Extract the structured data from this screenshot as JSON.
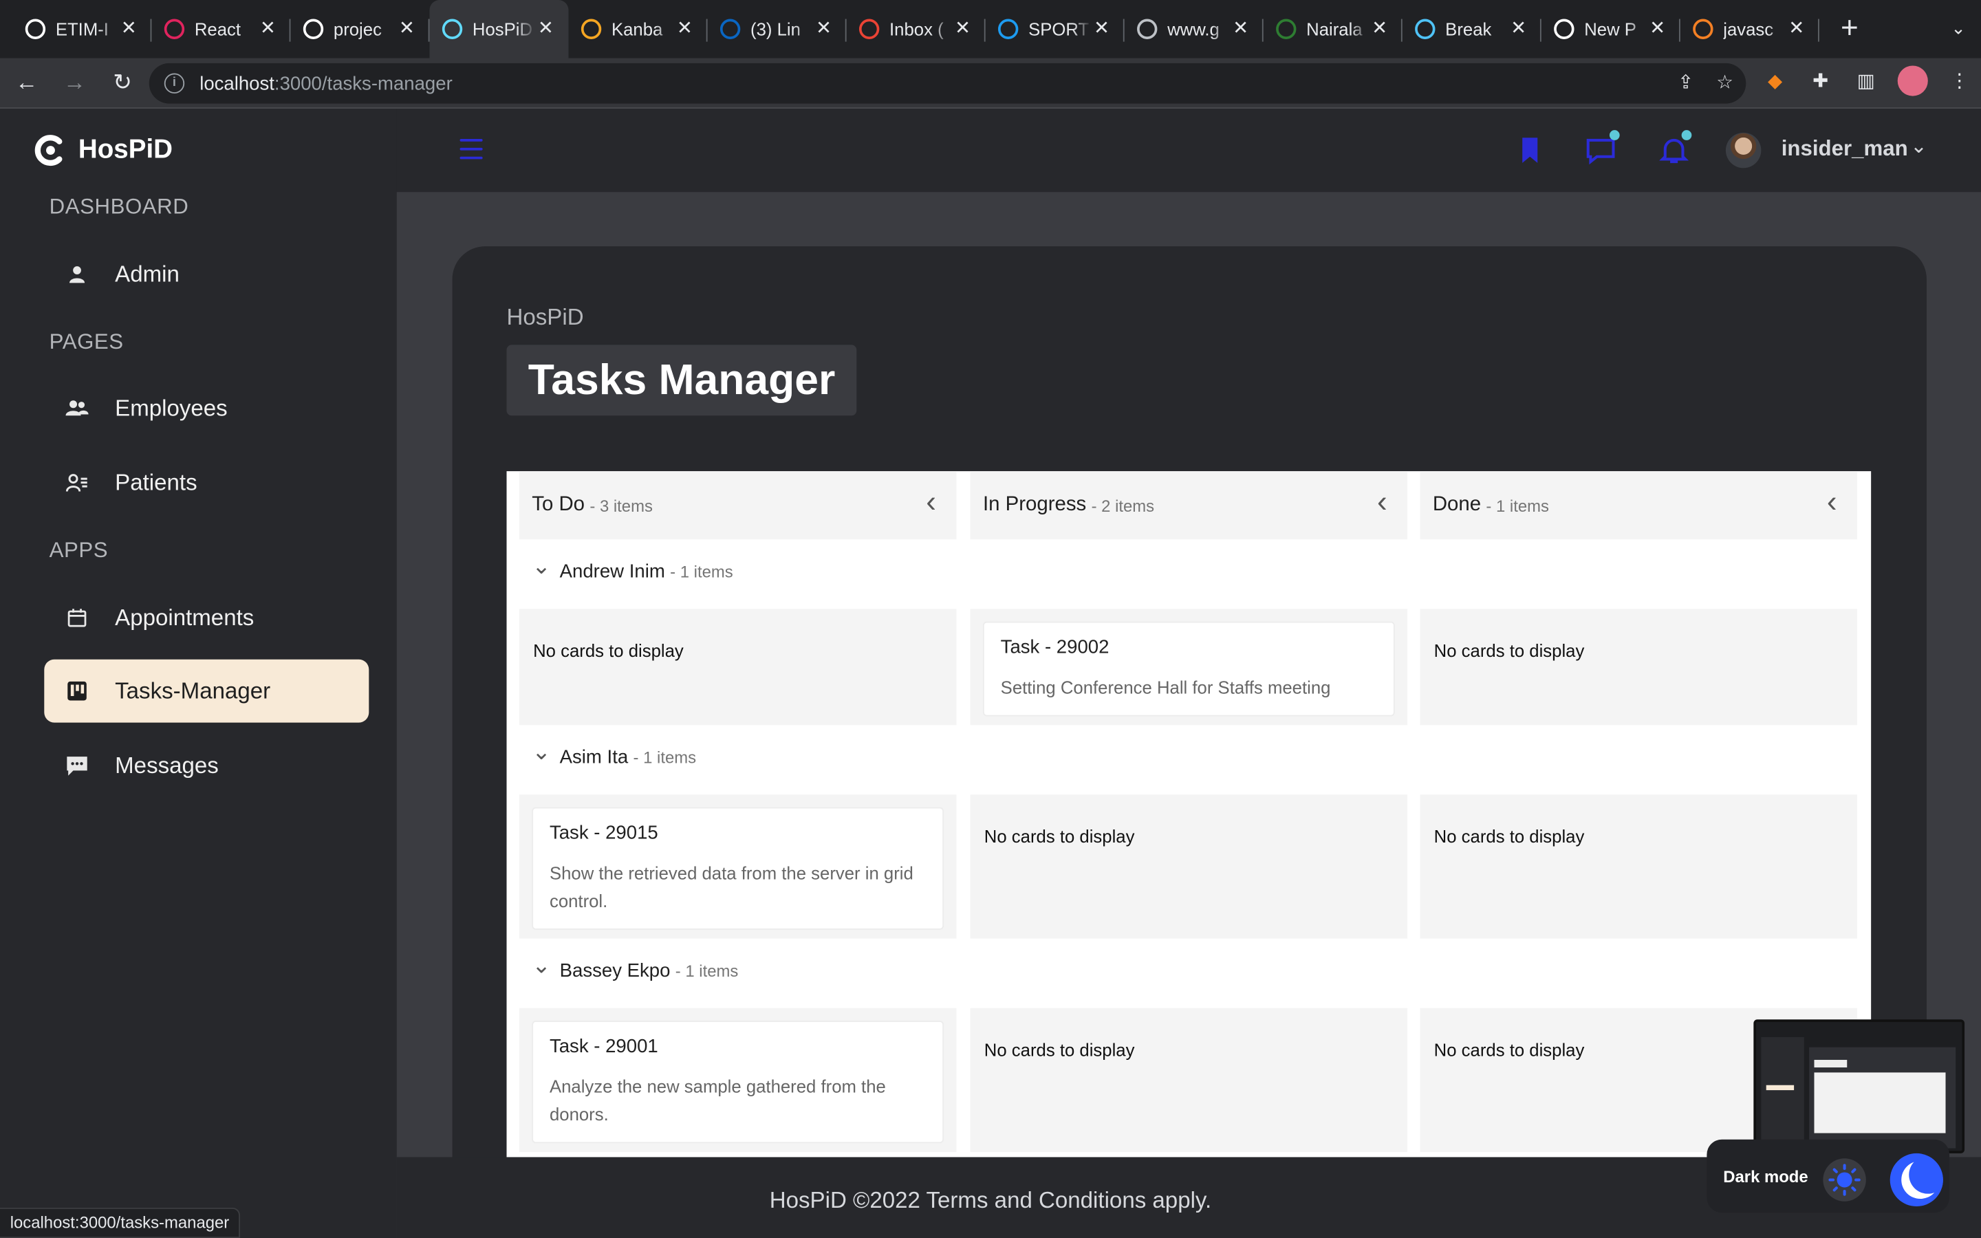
{
  "browser": {
    "tabs": [
      {
        "title": "ETIM-I",
        "favicon": "github-icon",
        "color": "#ffffff"
      },
      {
        "title": "React",
        "favicon": "react-icon",
        "color": "#e0245e"
      },
      {
        "title": "projec",
        "favicon": "github-icon",
        "color": "#ffffff"
      },
      {
        "title": "HosPiD",
        "favicon": "react-icon",
        "color": "#61dafb",
        "active": true
      },
      {
        "title": "Kanba",
        "favicon": "kanban-icon",
        "color": "#f5a623"
      },
      {
        "title": "(3) Lin",
        "favicon": "linkedin-icon",
        "color": "#0a66c2"
      },
      {
        "title": "Inbox (",
        "favicon": "gmail-icon",
        "color": "#ea4335"
      },
      {
        "title": "SPORT",
        "favicon": "twitter-icon",
        "color": "#1d9bf0"
      },
      {
        "title": "www.g",
        "favicon": "globe-icon",
        "color": "#bdc1c6"
      },
      {
        "title": "Nairala",
        "favicon": "nairaland-icon",
        "color": "#2e7d32"
      },
      {
        "title": "Break",
        "favicon": "gear-icon",
        "color": "#4fc3f7"
      },
      {
        "title": "New P",
        "favicon": "triangle-icon",
        "color": "#ffffff"
      },
      {
        "title": "javasc",
        "favicon": "stackoverflow-icon",
        "color": "#f48024"
      }
    ],
    "url_host": "localhost",
    "url_path": ":3000/tasks-manager",
    "status_url": "localhost:3000/tasks-manager"
  },
  "sidebar": {
    "brand": "HosPiD",
    "sections": {
      "dashboard": "DASHBOARD",
      "pages": "PAGES",
      "apps": "APPS"
    },
    "items": {
      "admin": "Admin",
      "employees": "Employees",
      "patients": "Patients",
      "appointments": "Appointments",
      "tasks": "Tasks-Manager",
      "messages": "Messages"
    },
    "active_item": "Tasks-Manager"
  },
  "topbar": {
    "username": "insider_man"
  },
  "page": {
    "breadcrumb": "HosPiD",
    "title": "Tasks Manager"
  },
  "kanban": {
    "columns": [
      {
        "title": "To Do",
        "count": "- 3 items"
      },
      {
        "title": "In Progress",
        "count": "- 2 items"
      },
      {
        "title": "Done",
        "count": "- 1 items"
      }
    ],
    "empty_text": "No cards to display",
    "swimlanes": [
      {
        "name": "Andrew Inim",
        "count": "- 1 items",
        "cards": [
          null,
          {
            "title": "Task - 29002",
            "desc": "Setting Conference Hall for Staffs meeting"
          },
          null
        ]
      },
      {
        "name": "Asim Ita",
        "count": "- 1 items",
        "cards": [
          {
            "title": "Task - 29015",
            "desc": "Show the retrieved data from the server in grid control."
          },
          null,
          null
        ]
      },
      {
        "name": "Bassey Ekpo",
        "count": "- 1 items",
        "cards": [
          {
            "title": "Task - 29001",
            "desc": "Analyze the new sample gathered from the donors."
          },
          null,
          null
        ]
      }
    ]
  },
  "footer": {
    "text": "HosPiD ©2022 Terms and Conditions apply."
  },
  "theme_toggle": {
    "label": "Dark mode"
  },
  "colors": {
    "accent": "#2b2bd8",
    "active_nav": "#f8ead7",
    "notification_dot": "#5ec8d8"
  }
}
